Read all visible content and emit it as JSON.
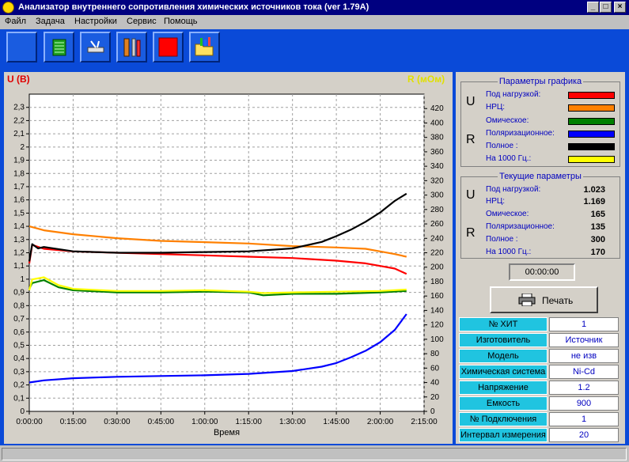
{
  "window": {
    "title": "Анализатор внутреннего сопротивления химических источников тока (ver 1.79A)",
    "minimize": "_",
    "maximize": "□",
    "close": "×"
  },
  "menu": [
    "Файл",
    "Задача",
    "Настройки",
    "Сервис",
    "Помощь"
  ],
  "toolbar": {
    "buttons": [
      "blank-button",
      "table-button",
      "probe-button",
      "tools-button",
      "stop-button",
      "open-folder-button"
    ]
  },
  "chart_data": {
    "type": "line",
    "y_left_label": "U (B)",
    "y_right_label": "R (мОм)",
    "xlabel": "Время",
    "xlim_minutes": [
      0,
      135
    ],
    "x_ticks": [
      "0:00:00",
      "0:15:00",
      "0:30:00",
      "0:45:00",
      "1:00:00",
      "1:15:00",
      "1:30:00",
      "1:45:00",
      "2:00:00",
      "2:15:00"
    ],
    "ylim_left": [
      0,
      2.4
    ],
    "ylim_right": [
      0,
      440
    ],
    "y_left_ticks": [
      "0",
      "0,1",
      "0,2",
      "0,3",
      "0,4",
      "0,5",
      "0,6",
      "0,7",
      "0,8",
      "0,9",
      "1",
      "1,1",
      "1,2",
      "1,3",
      "1,4",
      "1,5",
      "1,6",
      "1,7",
      "1,8",
      "1,9",
      "2",
      "2,1",
      "2,2",
      "2,3"
    ],
    "y_right_ticks": [
      "0",
      "20",
      "40",
      "60",
      "80",
      "100",
      "120",
      "140",
      "160",
      "180",
      "200",
      "220",
      "240",
      "260",
      "280",
      "300",
      "320",
      "340",
      "360",
      "380",
      "400",
      "420"
    ],
    "grid": true,
    "series": [
      {
        "name": "Под нагрузкой",
        "axis": "left",
        "color": "#ff0000",
        "x": [
          0,
          1,
          5,
          15,
          30,
          45,
          60,
          75,
          90,
          105,
          115,
          120,
          125,
          129
        ],
        "y": [
          1.12,
          1.26,
          1.23,
          1.21,
          1.2,
          1.19,
          1.18,
          1.17,
          1.16,
          1.14,
          1.12,
          1.1,
          1.08,
          1.04
        ]
      },
      {
        "name": "НРЦ",
        "axis": "left",
        "color": "#ff8000",
        "x": [
          0,
          5,
          15,
          30,
          45,
          60,
          75,
          90,
          105,
          115,
          120,
          125,
          129
        ],
        "y": [
          1.4,
          1.37,
          1.34,
          1.31,
          1.29,
          1.28,
          1.27,
          1.25,
          1.24,
          1.23,
          1.21,
          1.19,
          1.17
        ]
      },
      {
        "name": "Омическое",
        "axis": "right",
        "color": "#008000",
        "x": [
          0,
          1,
          5,
          10,
          15,
          30,
          45,
          60,
          75,
          80,
          90,
          105,
          120,
          129
        ],
        "y": [
          170,
          178,
          182,
          172,
          168,
          165,
          165,
          166,
          165,
          161,
          163,
          163,
          165,
          167
        ]
      },
      {
        "name": "Поляризационное",
        "axis": "right",
        "color": "#0000ff",
        "x": [
          0,
          5,
          15,
          30,
          45,
          60,
          75,
          90,
          100,
          105,
          110,
          115,
          120,
          125,
          129
        ],
        "y": [
          40,
          43,
          46,
          48,
          49,
          50,
          52,
          56,
          62,
          67,
          75,
          84,
          96,
          113,
          135
        ]
      },
      {
        "name": "Полное",
        "axis": "right",
        "color": "#000000",
        "x": [
          0,
          1,
          3,
          5,
          15,
          30,
          45,
          60,
          75,
          90,
          100,
          105,
          110,
          115,
          120,
          125,
          129
        ],
        "y": [
          208,
          232,
          226,
          228,
          222,
          220,
          220,
          221,
          222,
          226,
          235,
          243,
          252,
          263,
          276,
          292,
          302
        ]
      },
      {
        "name": "На 1000 Гц.",
        "axis": "right",
        "color": "#ffff00",
        "x": [
          0,
          1,
          5,
          10,
          15,
          30,
          45,
          60,
          75,
          80,
          90,
          105,
          120,
          129
        ],
        "y": [
          168,
          183,
          186,
          175,
          170,
          167,
          167,
          168,
          166,
          164,
          165,
          166,
          167,
          169
        ]
      }
    ]
  },
  "graph_params": {
    "title": "Параметры графика",
    "u_label": "U",
    "r_label": "R",
    "items": [
      {
        "label": "Под нагрузкой:",
        "color": "#ff0000"
      },
      {
        "label": "НРЦ:",
        "color": "#ff8000"
      },
      {
        "label": "Омическое:",
        "color": "#008000"
      },
      {
        "label": "Поляризационное:",
        "color": "#0000ff"
      },
      {
        "label": "Полное :",
        "color": "#000000"
      },
      {
        "label": "На 1000 Гц.:",
        "color": "#ffff00"
      }
    ]
  },
  "current_params": {
    "title": "Текущие параметры",
    "u_label": "U",
    "r_label": "R",
    "items": [
      {
        "label": "Под нагрузкой:",
        "value": "1.023"
      },
      {
        "label": "НРЦ:",
        "value": "1.169"
      },
      {
        "label": "Омическое:",
        "value": "165"
      },
      {
        "label": "Поляризационное:",
        "value": "135"
      },
      {
        "label": "Полное :",
        "value": "300"
      },
      {
        "label": "На 1000 Гц.:",
        "value": "170"
      }
    ]
  },
  "timer": "00:00:00",
  "print_button": "Печать",
  "info": [
    {
      "key": "№ ХИТ",
      "value": "1"
    },
    {
      "key": "Изготовитель",
      "value": "Источник"
    },
    {
      "key": "Модель",
      "value": "не изв"
    },
    {
      "key": "Химическая система",
      "value": "Ni-Cd"
    },
    {
      "key": "Напряжение",
      "value": "1.2"
    },
    {
      "key": "Емкость",
      "value": "900"
    },
    {
      "key": "№ Подключения",
      "value": "1"
    },
    {
      "key": "Интервал измерения",
      "value": "20"
    }
  ]
}
